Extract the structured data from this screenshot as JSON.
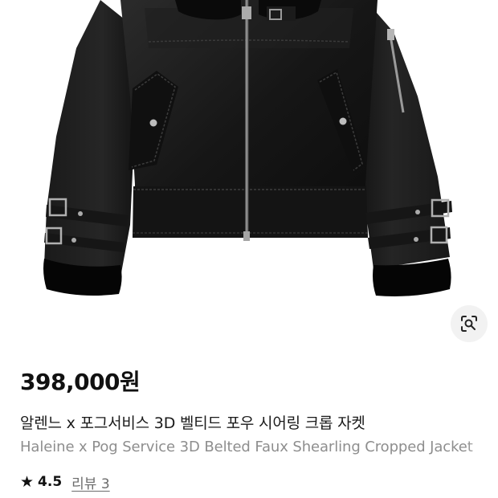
{
  "product": {
    "image_alt": "black faux shearling cropped jacket",
    "price": "398,000원",
    "title_ko": "알렌느 x 포그서비스 3D 벨티드 포우 시어링 크롭 자켓",
    "title_en": "Haleine x Pog Service 3D Belted Faux Shearling Cropped Jacket"
  },
  "rating": {
    "value": "4.5",
    "reviews_label": "리뷰 3"
  },
  "icons": {
    "lens": "image-search-icon",
    "star": "star-icon"
  },
  "colors": {
    "text_primary": "#111111",
    "text_secondary": "#8e8e8e",
    "link": "#6b6b6b",
    "lens_bg": "#f2f2f2"
  }
}
